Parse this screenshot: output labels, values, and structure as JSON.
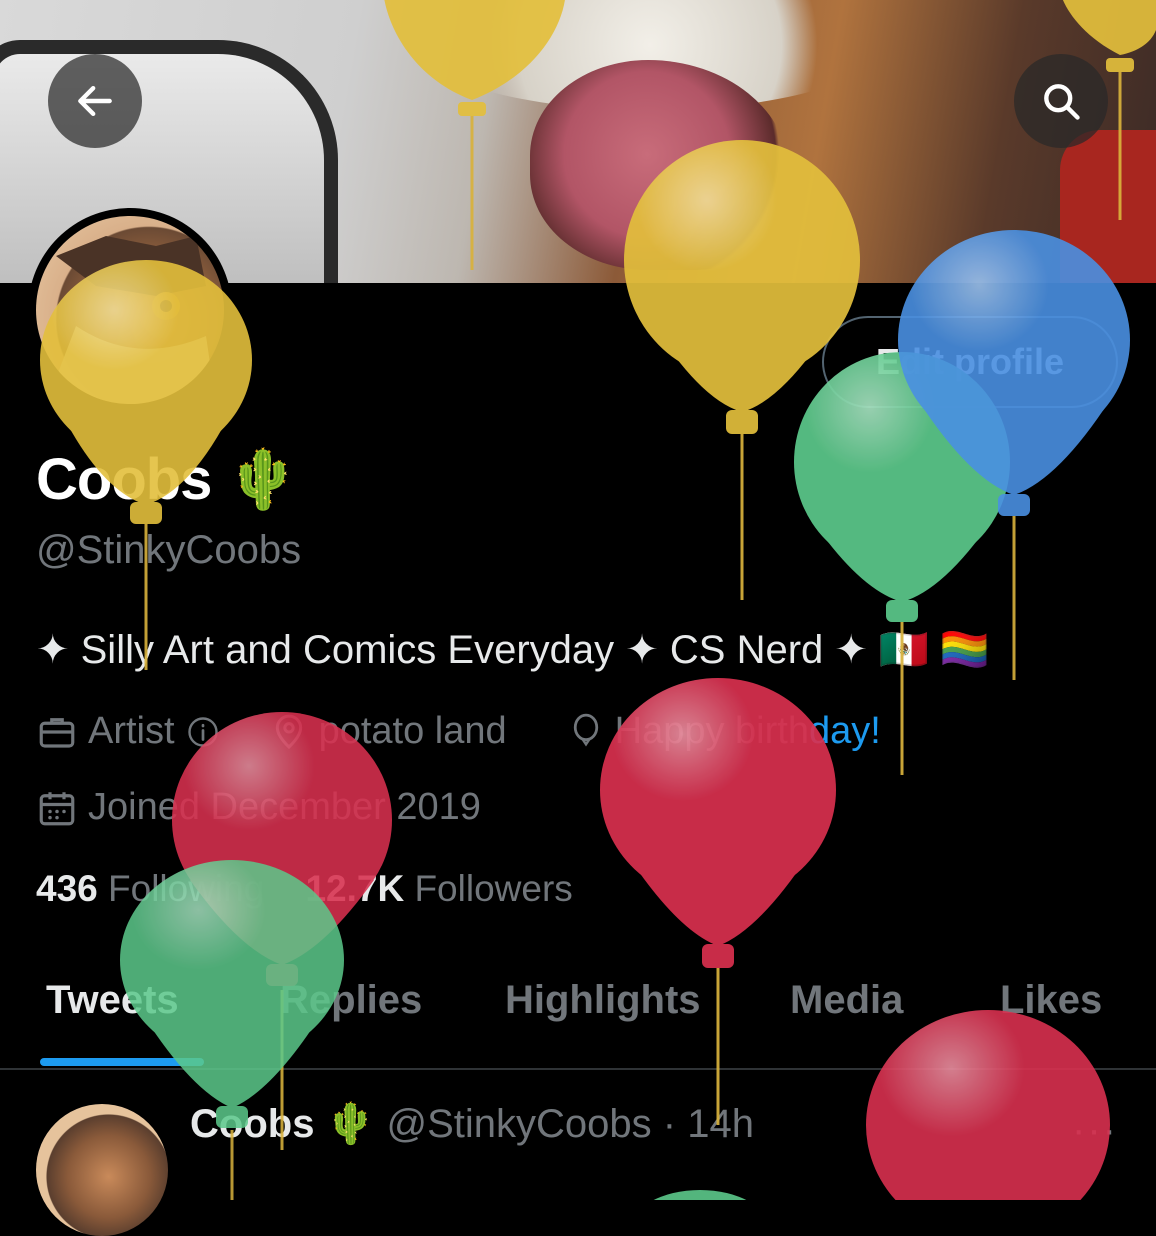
{
  "header": {
    "back_icon": "arrow-left-icon",
    "search_icon": "search-icon"
  },
  "profile": {
    "name": "Coobs",
    "name_emoji": "🌵",
    "handle": "@StinkyCoobs",
    "bio": "✦ Silly Art and Comics Everyday ✦ CS Nerd ✦ 🇲🇽 🏳️‍🌈",
    "edit_button_label": "Edit profile",
    "meta": {
      "category": "Artist",
      "location": "potato land",
      "birthday_prefix": "Happy birth",
      "birthday_suffix": "day!",
      "joined": "Joined December 2019"
    },
    "following_count": "436",
    "following_label": "Following",
    "followers_count": "12.7K",
    "followers_label": "Followers"
  },
  "tabs": [
    {
      "label": "Tweets"
    },
    {
      "label": "Replies"
    },
    {
      "label": "Highlights"
    },
    {
      "label": "Media"
    },
    {
      "label": "Likes"
    }
  ],
  "tweet": {
    "name": "Coobs",
    "emoji": "🌵",
    "handle": "@StinkyCoobs",
    "sep": "·",
    "time": "14h",
    "more": "···"
  },
  "colors": {
    "accent": "#1d9bf0",
    "balloon_yellow": "#e3bf3c",
    "balloon_green": "#5cc98b",
    "balloon_blue": "#4a90e2",
    "balloon_red": "#d9304f"
  }
}
